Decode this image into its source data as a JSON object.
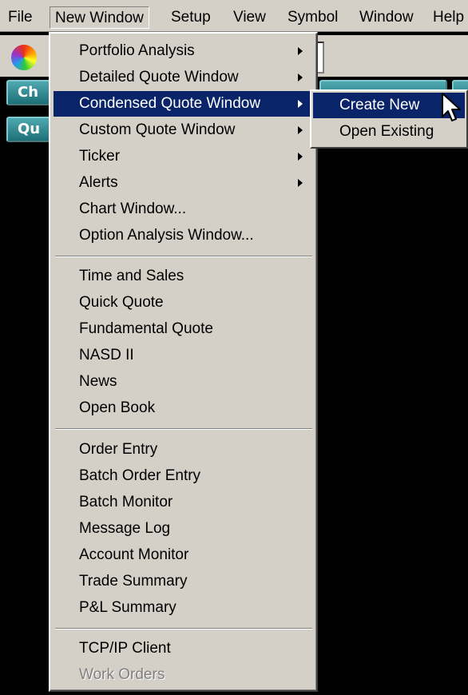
{
  "menubar": {
    "items": [
      "File",
      "New Window",
      "Setup",
      "View",
      "Symbol",
      "Window",
      "Help"
    ],
    "open_item": "New Window"
  },
  "toolbar": {
    "buttons": [
      "Ch",
      "Qu"
    ]
  },
  "menu": {
    "groups": [
      {
        "items": [
          {
            "label": "Portfolio Analysis",
            "submenu": true
          },
          {
            "label": "Detailed Quote Window",
            "submenu": true
          },
          {
            "label": "Condensed Quote Window",
            "submenu": true,
            "highlighted": true
          },
          {
            "label": "Custom Quote Window",
            "submenu": true
          },
          {
            "label": "Ticker",
            "submenu": true
          },
          {
            "label": "Alerts",
            "submenu": true
          },
          {
            "label": "Chart Window...",
            "submenu": false
          },
          {
            "label": "Option Analysis Window...",
            "submenu": false
          }
        ]
      },
      {
        "items": [
          {
            "label": "Time and Sales"
          },
          {
            "label": "Quick Quote"
          },
          {
            "label": "Fundamental Quote"
          },
          {
            "label": "NASD II"
          },
          {
            "label": "News"
          },
          {
            "label": "Open Book"
          }
        ]
      },
      {
        "items": [
          {
            "label": "Order Entry"
          },
          {
            "label": "Batch Order Entry"
          },
          {
            "label": "Batch Monitor"
          },
          {
            "label": "Message Log"
          },
          {
            "label": "Account Monitor"
          },
          {
            "label": "Trade Summary"
          },
          {
            "label": "P&L Summary"
          }
        ]
      },
      {
        "items": [
          {
            "label": "TCP/IP Client"
          },
          {
            "label": "Work Orders",
            "disabled": true
          }
        ]
      }
    ]
  },
  "submenu": {
    "items": [
      {
        "label": "Create New",
        "highlighted": true
      },
      {
        "label": "Open Existing"
      }
    ]
  },
  "colors": {
    "menu_bg": "#d4d0c8",
    "highlight": "#0a246a",
    "teal_button": "#2a8a92"
  },
  "icons": [
    "color-wheel-icon",
    "submenu-arrow-icon",
    "mouse-cursor-icon"
  ]
}
